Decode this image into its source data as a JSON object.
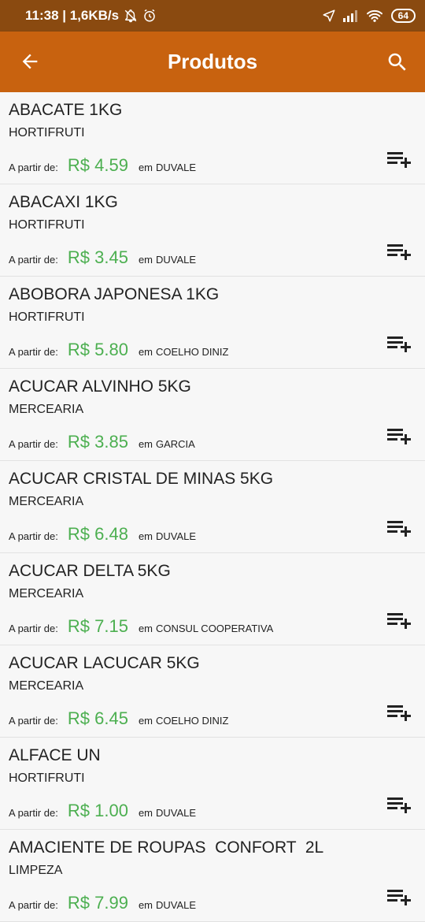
{
  "status_bar": {
    "time_speed": "11:38 | 1,6KB/s",
    "battery": "64"
  },
  "appbar": {
    "title": "Produtos"
  },
  "labels": {
    "price_prefix": "A partir de:",
    "store_prefix": "em"
  },
  "products": [
    {
      "name": "ABACATE 1KG",
      "category": "HORTIFRUTI",
      "price": "R$ 4.59",
      "store": "DUVALE"
    },
    {
      "name": "ABACAXI 1KG",
      "category": "HORTIFRUTI",
      "price": "R$ 3.45",
      "store": "DUVALE"
    },
    {
      "name": "ABOBORA JAPONESA 1KG",
      "category": "HORTIFRUTI",
      "price": "R$ 5.80",
      "store": "COELHO DINIZ"
    },
    {
      "name": "ACUCAR ALVINHO 5KG",
      "category": "MERCEARIA",
      "price": "R$ 3.85",
      "store": "GARCIA"
    },
    {
      "name": "ACUCAR CRISTAL DE MINAS 5KG",
      "category": "MERCEARIA",
      "price": "R$ 6.48",
      "store": "DUVALE"
    },
    {
      "name": "ACUCAR DELTA 5KG",
      "category": "MERCEARIA",
      "price": "R$ 7.15",
      "store": "CONSUL COOPERATIVA"
    },
    {
      "name": "ACUCAR LACUCAR 5KG",
      "category": "MERCEARIA",
      "price": "R$ 6.45",
      "store": "COELHO DINIZ"
    },
    {
      "name": "ALFACE UN",
      "category": "HORTIFRUTI",
      "price": "R$ 1.00",
      "store": "DUVALE"
    },
    {
      "name": "AMACIENTE DE ROUPAS  CONFORT  2L",
      "category": "LIMPEZA",
      "price": "R$ 7.99",
      "store": "DUVALE"
    }
  ],
  "colors": {
    "status_bar": "#8a4a10",
    "app_bar": "#c8620f",
    "price": "#4caf50",
    "background": "#f7f7f7"
  },
  "icons": {
    "back": "arrow-back-icon",
    "search": "search-icon",
    "add": "playlist-add-icon"
  }
}
